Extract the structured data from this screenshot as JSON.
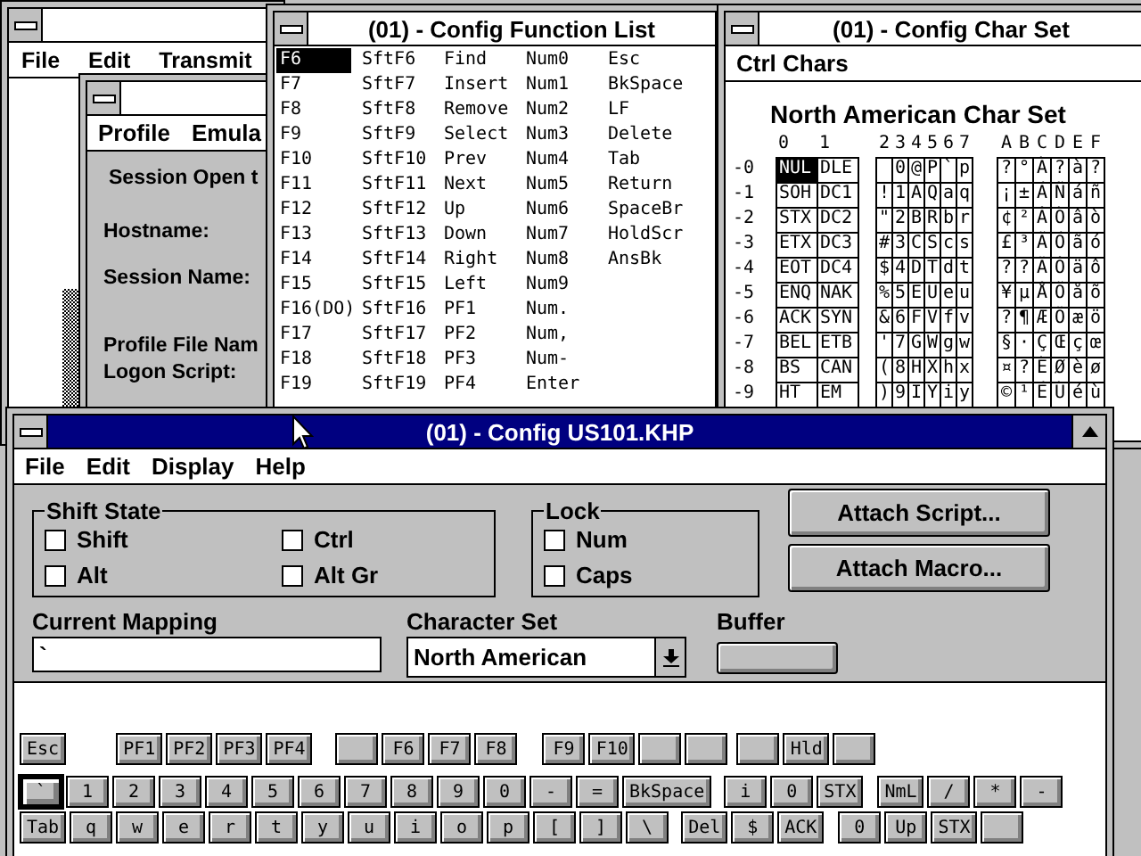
{
  "session_window": {
    "active": false,
    "menu": [
      "File",
      "Edit",
      "Transmit"
    ]
  },
  "profile_window": {
    "active": false,
    "menu": [
      "Profile",
      "Emula"
    ],
    "labels": [
      "Session Open t",
      "Hostname:",
      "Session Name:",
      "Profile File Nam",
      "Logon Script:"
    ]
  },
  "function_list": {
    "title": "(01) - Config Function List",
    "active": false,
    "columns": [
      [
        {
          "label": "F6",
          "selected": true
        },
        {
          "label": "F7",
          "selected": false
        },
        {
          "label": "F8",
          "selected": false
        },
        {
          "label": "F9",
          "selected": false
        },
        {
          "label": "F10",
          "selected": false
        },
        {
          "label": "F11",
          "selected": false
        },
        {
          "label": "F12",
          "selected": false
        },
        {
          "label": "F13",
          "selected": false
        },
        {
          "label": "F14",
          "selected": false
        },
        {
          "label": "F15",
          "selected": false
        },
        {
          "label": "F16(DO)",
          "selected": false
        },
        {
          "label": "F17",
          "selected": false
        },
        {
          "label": "F18",
          "selected": false
        },
        {
          "label": "F19",
          "selected": false
        }
      ],
      [
        {
          "label": "SftF6",
          "selected": false
        },
        {
          "label": "SftF7",
          "selected": false
        },
        {
          "label": "SftF8",
          "selected": false
        },
        {
          "label": "SftF9",
          "selected": false
        },
        {
          "label": "SftF10",
          "selected": false
        },
        {
          "label": "SftF11",
          "selected": false
        },
        {
          "label": "SftF12",
          "selected": false
        },
        {
          "label": "SftF13",
          "selected": false
        },
        {
          "label": "SftF14",
          "selected": false
        },
        {
          "label": "SftF15",
          "selected": false
        },
        {
          "label": "SftF16",
          "selected": false
        },
        {
          "label": "SftF17",
          "selected": false
        },
        {
          "label": "SftF18",
          "selected": false
        },
        {
          "label": "SftF19",
          "selected": false
        }
      ],
      [
        {
          "label": "Find",
          "selected": false
        },
        {
          "label": "Insert",
          "selected": false
        },
        {
          "label": "Remove",
          "selected": false
        },
        {
          "label": "Select",
          "selected": false
        },
        {
          "label": "Prev",
          "selected": false
        },
        {
          "label": "Next",
          "selected": false
        },
        {
          "label": "Up",
          "selected": false
        },
        {
          "label": "Down",
          "selected": false
        },
        {
          "label": "Right",
          "selected": false
        },
        {
          "label": "Left",
          "selected": false
        },
        {
          "label": "PF1",
          "selected": false
        },
        {
          "label": "PF2",
          "selected": false
        },
        {
          "label": "PF3",
          "selected": false
        },
        {
          "label": "PF4",
          "selected": false
        }
      ],
      [
        {
          "label": "Num0",
          "selected": false
        },
        {
          "label": "Num1",
          "selected": false
        },
        {
          "label": "Num2",
          "selected": false
        },
        {
          "label": "Num3",
          "selected": false
        },
        {
          "label": "Num4",
          "selected": false
        },
        {
          "label": "Num5",
          "selected": false
        },
        {
          "label": "Num6",
          "selected": false
        },
        {
          "label": "Num7",
          "selected": false
        },
        {
          "label": "Num8",
          "selected": false
        },
        {
          "label": "Num9",
          "selected": false
        },
        {
          "label": "Num.",
          "selected": false
        },
        {
          "label": "Num,",
          "selected": false
        },
        {
          "label": "Num-",
          "selected": false
        },
        {
          "label": "Enter",
          "selected": false
        }
      ],
      [
        {
          "label": "Esc",
          "selected": false
        },
        {
          "label": "BkSpace",
          "selected": false
        },
        {
          "label": "LF",
          "selected": false
        },
        {
          "label": "Delete",
          "selected": false
        },
        {
          "label": "Tab",
          "selected": false
        },
        {
          "label": "Return",
          "selected": false
        },
        {
          "label": "SpaceBr",
          "selected": false
        },
        {
          "label": "HoldScr",
          "selected": false
        },
        {
          "label": "AnsBk",
          "selected": false
        }
      ]
    ]
  },
  "char_set": {
    "title": "(01) - Config Char Set",
    "active": false,
    "menu": [
      "Ctrl Chars"
    ],
    "heading": "North American Char Set",
    "control_headers": [
      "0",
      "1"
    ],
    "ascii_headers": [
      "2",
      "3",
      "4",
      "5",
      "6",
      "7"
    ],
    "latin_headers": [
      "A",
      "B",
      "C",
      "D",
      "E",
      "F"
    ],
    "rows": [
      {
        "label": "-0",
        "control": [
          {
            "label": "NUL",
            "selected": true
          },
          {
            "label": "DLE",
            "selected": false
          }
        ],
        "ascii": [
          "0",
          "@",
          "P",
          "`",
          "p"
        ],
        "latin": [
          "?",
          "°",
          "À",
          "?",
          "à",
          "?"
        ]
      },
      {
        "label": "-1",
        "control": [
          {
            "label": "SOH",
            "selected": false
          },
          {
            "label": "DC1",
            "selected": false
          }
        ],
        "ascii": [
          "!",
          "1",
          "A",
          "Q",
          "a",
          "q"
        ],
        "latin": [
          "¡",
          "±",
          "Á",
          "Ñ",
          "á",
          "ñ"
        ]
      },
      {
        "label": "-2",
        "control": [
          {
            "label": "STX",
            "selected": false
          },
          {
            "label": "DC2",
            "selected": false
          }
        ],
        "ascii": [
          "\"",
          "2",
          "B",
          "R",
          "b",
          "r"
        ],
        "latin": [
          "¢",
          "²",
          "Â",
          "Ò",
          "â",
          "ò"
        ]
      },
      {
        "label": "-3",
        "control": [
          {
            "label": "ETX",
            "selected": false
          },
          {
            "label": "DC3",
            "selected": false
          }
        ],
        "ascii": [
          "#",
          "3",
          "C",
          "S",
          "c",
          "s"
        ],
        "latin": [
          "£",
          "³",
          "Ã",
          "Ó",
          "ã",
          "ó"
        ]
      },
      {
        "label": "-4",
        "control": [
          {
            "label": "EOT",
            "selected": false
          },
          {
            "label": "DC4",
            "selected": false
          }
        ],
        "ascii": [
          "$",
          "4",
          "D",
          "T",
          "d",
          "t"
        ],
        "latin": [
          "?",
          "?",
          "Ä",
          "Ô",
          "ä",
          "ô"
        ]
      },
      {
        "label": "-5",
        "control": [
          {
            "label": "ENQ",
            "selected": false
          },
          {
            "label": "NAK",
            "selected": false
          }
        ],
        "ascii": [
          "%",
          "5",
          "E",
          "U",
          "e",
          "u"
        ],
        "latin": [
          "¥",
          "µ",
          "Å",
          "Õ",
          "å",
          "õ"
        ]
      },
      {
        "label": "-6",
        "control": [
          {
            "label": "ACK",
            "selected": false
          },
          {
            "label": "SYN",
            "selected": false
          }
        ],
        "ascii": [
          "&",
          "6",
          "F",
          "V",
          "f",
          "v"
        ],
        "latin": [
          "?",
          "¶",
          "Æ",
          "Ö",
          "æ",
          "ö"
        ]
      },
      {
        "label": "-7",
        "control": [
          {
            "label": "BEL",
            "selected": false
          },
          {
            "label": "ETB",
            "selected": false
          }
        ],
        "ascii": [
          "'",
          "7",
          "G",
          "W",
          "g",
          "w"
        ],
        "latin": [
          "§",
          "·",
          "Ç",
          "Œ",
          "ç",
          "œ"
        ]
      },
      {
        "label": "-8",
        "control": [
          {
            "label": "BS",
            "selected": false
          },
          {
            "label": "CAN",
            "selected": false
          }
        ],
        "ascii": [
          "(",
          "8",
          "H",
          "X",
          "h",
          "x"
        ],
        "latin": [
          "¤",
          "?",
          "È",
          "Ø",
          "è",
          "ø"
        ]
      },
      {
        "label": "-9",
        "control": [
          {
            "label": "HT",
            "selected": false
          },
          {
            "label": "EM",
            "selected": false
          }
        ],
        "ascii": [
          ")",
          "9",
          "I",
          "Y",
          "i",
          "y"
        ],
        "latin": [
          "©",
          "¹",
          "É",
          "Ù",
          "é",
          "ù"
        ]
      }
    ]
  },
  "config_dialog": {
    "title": "(01) - Config US101.KHP",
    "active": true,
    "menu": [
      "File",
      "Edit",
      "Display",
      "Help"
    ],
    "shift_state": {
      "label": "Shift State",
      "options": [
        {
          "label": "Shift",
          "checked": false
        },
        {
          "label": "Ctrl",
          "checked": false
        },
        {
          "label": "Alt",
          "checked": false
        },
        {
          "label": "Alt Gr",
          "checked": false
        }
      ]
    },
    "lock": {
      "label": "Lock",
      "options": [
        {
          "label": "Num",
          "checked": false
        },
        {
          "label": "Caps",
          "checked": false
        }
      ]
    },
    "buttons": [
      "Attach Script...",
      "Attach Macro..."
    ],
    "current_mapping": {
      "label": "Current Mapping",
      "value": "`"
    },
    "character_set": {
      "label": "Character Set",
      "value": "North American"
    },
    "buffer": {
      "label": "Buffer"
    },
    "keyboard": {
      "rows": [
        {
          "groups": [
            [
              {
                "label": "Esc",
                "selected": false
              }
            ],
            [
              {
                "label": "PF1",
                "selected": false
              },
              {
                "label": "PF2",
                "selected": false
              },
              {
                "label": "PF3",
                "selected": false
              },
              {
                "label": "PF4",
                "selected": false
              }
            ],
            [
              {
                "selected": false
              },
              {
                "label": "F6",
                "selected": false
              },
              {
                "label": "F7",
                "selected": false
              },
              {
                "label": "F8",
                "selected": false
              }
            ],
            [
              {
                "label": "F9",
                "selected": false
              },
              {
                "label": "F10",
                "selected": false
              },
              {
                "selected": false
              },
              {
                "selected": false
              }
            ],
            [
              {
                "selected": false
              },
              {
                "label": "Hld",
                "selected": false
              },
              {
                "selected": false
              }
            ]
          ]
        },
        {
          "groups": [
            [
              {
                "label": "`",
                "selected": true
              },
              {
                "label": "1",
                "selected": false
              },
              {
                "label": "2",
                "selected": false
              },
              {
                "label": "3",
                "selected": false
              },
              {
                "label": "4",
                "selected": false
              },
              {
                "label": "5",
                "selected": false
              },
              {
                "label": "6",
                "selected": false
              },
              {
                "label": "7",
                "selected": false
              },
              {
                "label": "8",
                "selected": false
              },
              {
                "label": "9",
                "selected": false
              },
              {
                "label": "0",
                "selected": false
              },
              {
                "label": "-",
                "selected": false
              },
              {
                "label": "=",
                "selected": false
              },
              {
                "label": "BkSpace",
                "selected": false
              }
            ],
            [
              {
                "label": "i",
                "selected": false
              },
              {
                "label": "0",
                "selected": false
              },
              {
                "label": "STX",
                "selected": false
              }
            ],
            [
              {
                "label": "NmL",
                "selected": false
              },
              {
                "label": "/",
                "selected": false
              },
              {
                "label": "*",
                "selected": false
              },
              {
                "label": "-",
                "selected": false
              }
            ]
          ]
        },
        {
          "groups": [
            [
              {
                "label": "Tab",
                "selected": false
              },
              {
                "label": "q",
                "selected": false
              },
              {
                "label": "w",
                "selected": false
              },
              {
                "label": "e",
                "selected": false
              },
              {
                "label": "r",
                "selected": false
              },
              {
                "label": "t",
                "selected": false
              },
              {
                "label": "y",
                "selected": false
              },
              {
                "label": "u",
                "selected": false
              },
              {
                "label": "i",
                "selected": false
              },
              {
                "label": "o",
                "selected": false
              },
              {
                "label": "p",
                "selected": false
              },
              {
                "label": "[",
                "selected": false
              },
              {
                "label": "]",
                "selected": false
              },
              {
                "label": "\\",
                "selected": false
              }
            ],
            [
              {
                "label": "Del",
                "selected": false
              },
              {
                "label": "$",
                "selected": false
              },
              {
                "label": "ACK",
                "selected": false
              }
            ],
            [
              {
                "label": "0",
                "selected": false
              },
              {
                "label": "Up",
                "selected": false
              },
              {
                "label": "STX",
                "selected": false
              },
              {
                "selected": false
              }
            ]
          ]
        }
      ]
    }
  }
}
